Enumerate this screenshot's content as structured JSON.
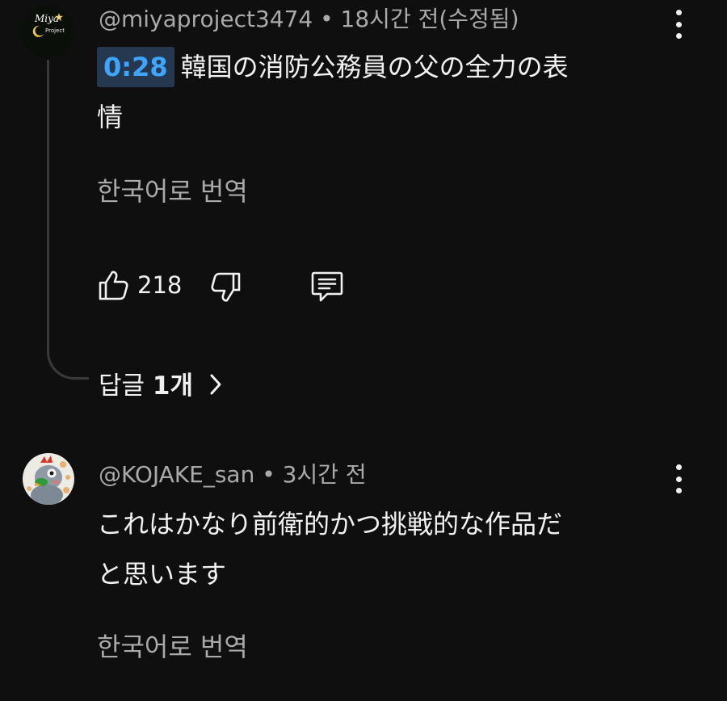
{
  "comments": [
    {
      "avatar_logo": "Miya",
      "avatar_sub": "Project",
      "author": "@miyaproject3474",
      "meta": "• 18시간 전(수정됨)",
      "timestamp_link": "0:28",
      "text_line1": "韓国の消防公務員の父の全力の表",
      "text_line2": "情",
      "translate": "한국어로 번역",
      "likes": "218",
      "replies_prefix": "답글 ",
      "replies_count": "1개"
    },
    {
      "author": "@KOJAKE_san",
      "meta": "• 3시간 전",
      "text_line1": "これはかなり前衛的かつ挑戦的な作品だ",
      "text_line2": "と思います",
      "translate": "한국어로 번역"
    }
  ],
  "icons": {
    "like": "thumbs-up-icon",
    "dislike": "thumbs-down-icon",
    "reply": "comment-icon",
    "more": "kebab-menu-icon",
    "chevron": "chevron-right-icon"
  },
  "colors": {
    "background": "#0f0f0f",
    "timestamp_link": "#3ea6ff",
    "timestamp_bg": "#263850",
    "secondary_text": "#aaaaaa"
  }
}
